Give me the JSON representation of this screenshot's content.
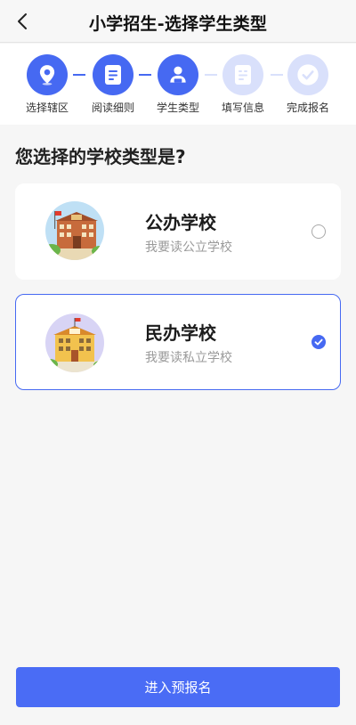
{
  "header": {
    "title": "小学招生-选择学生类型",
    "back_icon": "chevron-left-icon"
  },
  "steps": [
    {
      "label": "选择辖区",
      "state": "done",
      "icon": "map-pin-icon"
    },
    {
      "label": "阅读细则",
      "state": "done",
      "icon": "document-icon"
    },
    {
      "label": "学生类型",
      "state": "done",
      "icon": "student-icon"
    },
    {
      "label": "填写信息",
      "state": "todo",
      "icon": "form-icon"
    },
    {
      "label": "完成报名",
      "state": "todo",
      "icon": "check-circle-icon"
    }
  ],
  "question": "您选择的学校类型是?",
  "options": [
    {
      "title": "公办学校",
      "subtitle": "我要读公立学校",
      "selected": false
    },
    {
      "title": "民办学校",
      "subtitle": "我要读私立学校",
      "selected": true
    }
  ],
  "submit_label": "进入预报名",
  "colors": {
    "accent": "#4669f2",
    "accent_light": "#d9e0fb",
    "background": "#f6f6f6"
  }
}
